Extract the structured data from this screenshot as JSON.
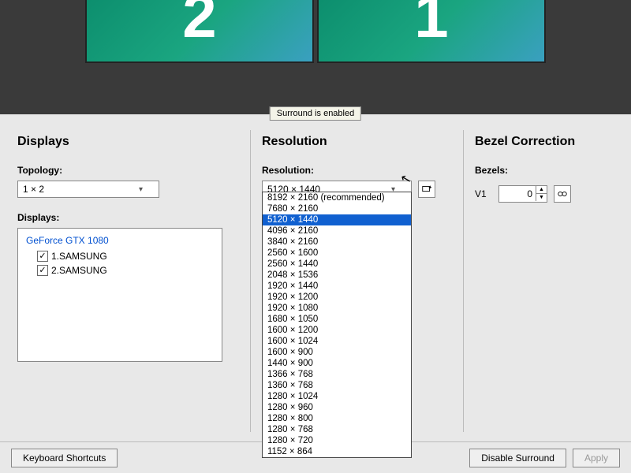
{
  "preview": {
    "monitor_left_number": "2",
    "monitor_right_number": "1",
    "tooltip": "Surround is enabled"
  },
  "displays_panel": {
    "title": "Displays",
    "topology_label": "Topology:",
    "topology_selected": "1 × 2",
    "displays_label": "Displays:",
    "gpu": "GeForce GTX 1080",
    "items": [
      {
        "checked": true,
        "label": "1.SAMSUNG"
      },
      {
        "checked": true,
        "label": "2.SAMSUNG"
      }
    ]
  },
  "resolution_panel": {
    "title": "Resolution",
    "resolution_label": "Resolution:",
    "selected": "5120 × 1440",
    "options": [
      "8192 × 2160 (recommended)",
      "7680 × 2160",
      "5120 × 1440",
      "4096 × 2160",
      "3840 × 2160",
      "2560 × 1600",
      "2560 × 1440",
      "2048 × 1536",
      "1920 × 1440",
      "1920 × 1200",
      "1920 × 1080",
      "1680 × 1050",
      "1600 × 1200",
      "1600 × 1024",
      "1600 × 900",
      "1440 × 900",
      "1366 × 768",
      "1360 × 768",
      "1280 × 1024",
      "1280 × 960",
      "1280 × 800",
      "1280 × 768",
      "1280 × 720",
      "1152 × 864"
    ],
    "highlighted_index": 2
  },
  "bezel_panel": {
    "title": "Bezel Correction",
    "bezels_label": "Bezels:",
    "v1_label": "V1",
    "v1_value": "0"
  },
  "footer": {
    "keyboard_shortcuts": "Keyboard Shortcuts",
    "disable_surround": "Disable Surround",
    "apply": "Apply"
  }
}
